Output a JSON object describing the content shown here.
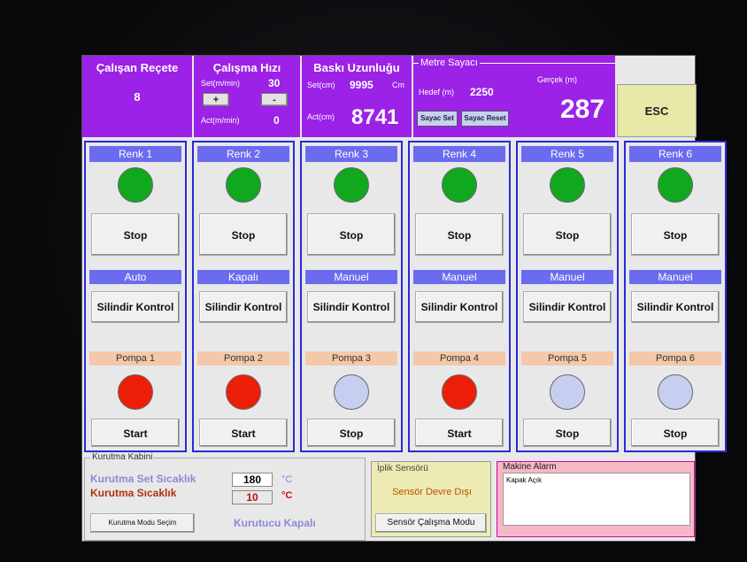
{
  "header": {
    "recipe_title": "Çalışan Reçete",
    "recipe_value": "8",
    "speed_title": "Çalışma Hızı",
    "speed_set_label": "Set(m/min)",
    "speed_set_value": "30",
    "speed_plus": "+",
    "speed_minus": "-",
    "speed_act_label": "Act(m/min)",
    "speed_act_value": "0",
    "print_title": "Baskı Uzunluğu",
    "print_set_label": "Set(cm)",
    "print_set_value": "9995",
    "print_unit": "Cm",
    "print_act_label": "Act(cm)",
    "print_act_value": "8741",
    "meter_title": "Metre Sayacı",
    "meter_target_label": "Hedef (m)",
    "meter_target_value": "2250",
    "meter_real_label": "Gerçek (m)",
    "meter_real_value": "287",
    "meter_set_btn": "Sayac Set",
    "meter_reset_btn": "Sayac Reset",
    "esc": "ESC"
  },
  "colors": [
    {
      "label": "Renk 1",
      "state": "Stop",
      "mode": "Auto",
      "cyl": "Silindir Kontrol",
      "pump": "Pompa 1",
      "pump_state": "Start",
      "led_top": "green",
      "led_pump": "red"
    },
    {
      "label": "Renk 2",
      "state": "Stop",
      "mode": "Kapalı",
      "cyl": "Silindir Kontrol",
      "pump": "Pompa 2",
      "pump_state": "Start",
      "led_top": "green",
      "led_pump": "red"
    },
    {
      "label": "Renk 3",
      "state": "Stop",
      "mode": "Manuel",
      "cyl": "Silindir Kontrol",
      "pump": "Pompa 3",
      "pump_state": "Stop",
      "led_top": "green",
      "led_pump": "pale"
    },
    {
      "label": "Renk 4",
      "state": "Stop",
      "mode": "Manuel",
      "cyl": "Silindir Kontrol",
      "pump": "Pompa 4",
      "pump_state": "Start",
      "led_top": "green",
      "led_pump": "red"
    },
    {
      "label": "Renk 5",
      "state": "Stop",
      "mode": "Manuel",
      "cyl": "Silindir Kontrol",
      "pump": "Pompa 5",
      "pump_state": "Stop",
      "led_top": "green",
      "led_pump": "pale"
    },
    {
      "label": "Renk 6",
      "state": "Stop",
      "mode": "Manuel",
      "cyl": "Silindir Kontrol",
      "pump": "Pompa 6",
      "pump_state": "Stop",
      "led_top": "green",
      "led_pump": "pale"
    }
  ],
  "dryer": {
    "title": "Kurutma Kabini",
    "set_temp_label": "Kurutma Set Sıcaklık",
    "set_temp_value": "180",
    "set_temp_unit": "°C",
    "temp_label": "Kurutma Sıcaklık",
    "temp_value": "10",
    "temp_unit": "°C",
    "mode_button": "Kurutma Modu Seçim",
    "status": "Kurutucu Kapalı"
  },
  "thread_sensor": {
    "title": "İplik Sensörü",
    "status": "Sensör Devre Dışı",
    "mode_button": "Sensör Çalışma Modu"
  },
  "alarm": {
    "title": "Makine Alarm",
    "message": "Kapak Açık"
  },
  "palette": {
    "purple": "#9b22e6",
    "blue_header": "#6b6bf0",
    "border_blue": "#2a2ad8",
    "led_green": "#0fa81e",
    "led_red": "#ec1e08",
    "led_pale": "#c6cff0",
    "pump_header": "#f4c8a8",
    "esc_bg": "#e8e8a8"
  }
}
